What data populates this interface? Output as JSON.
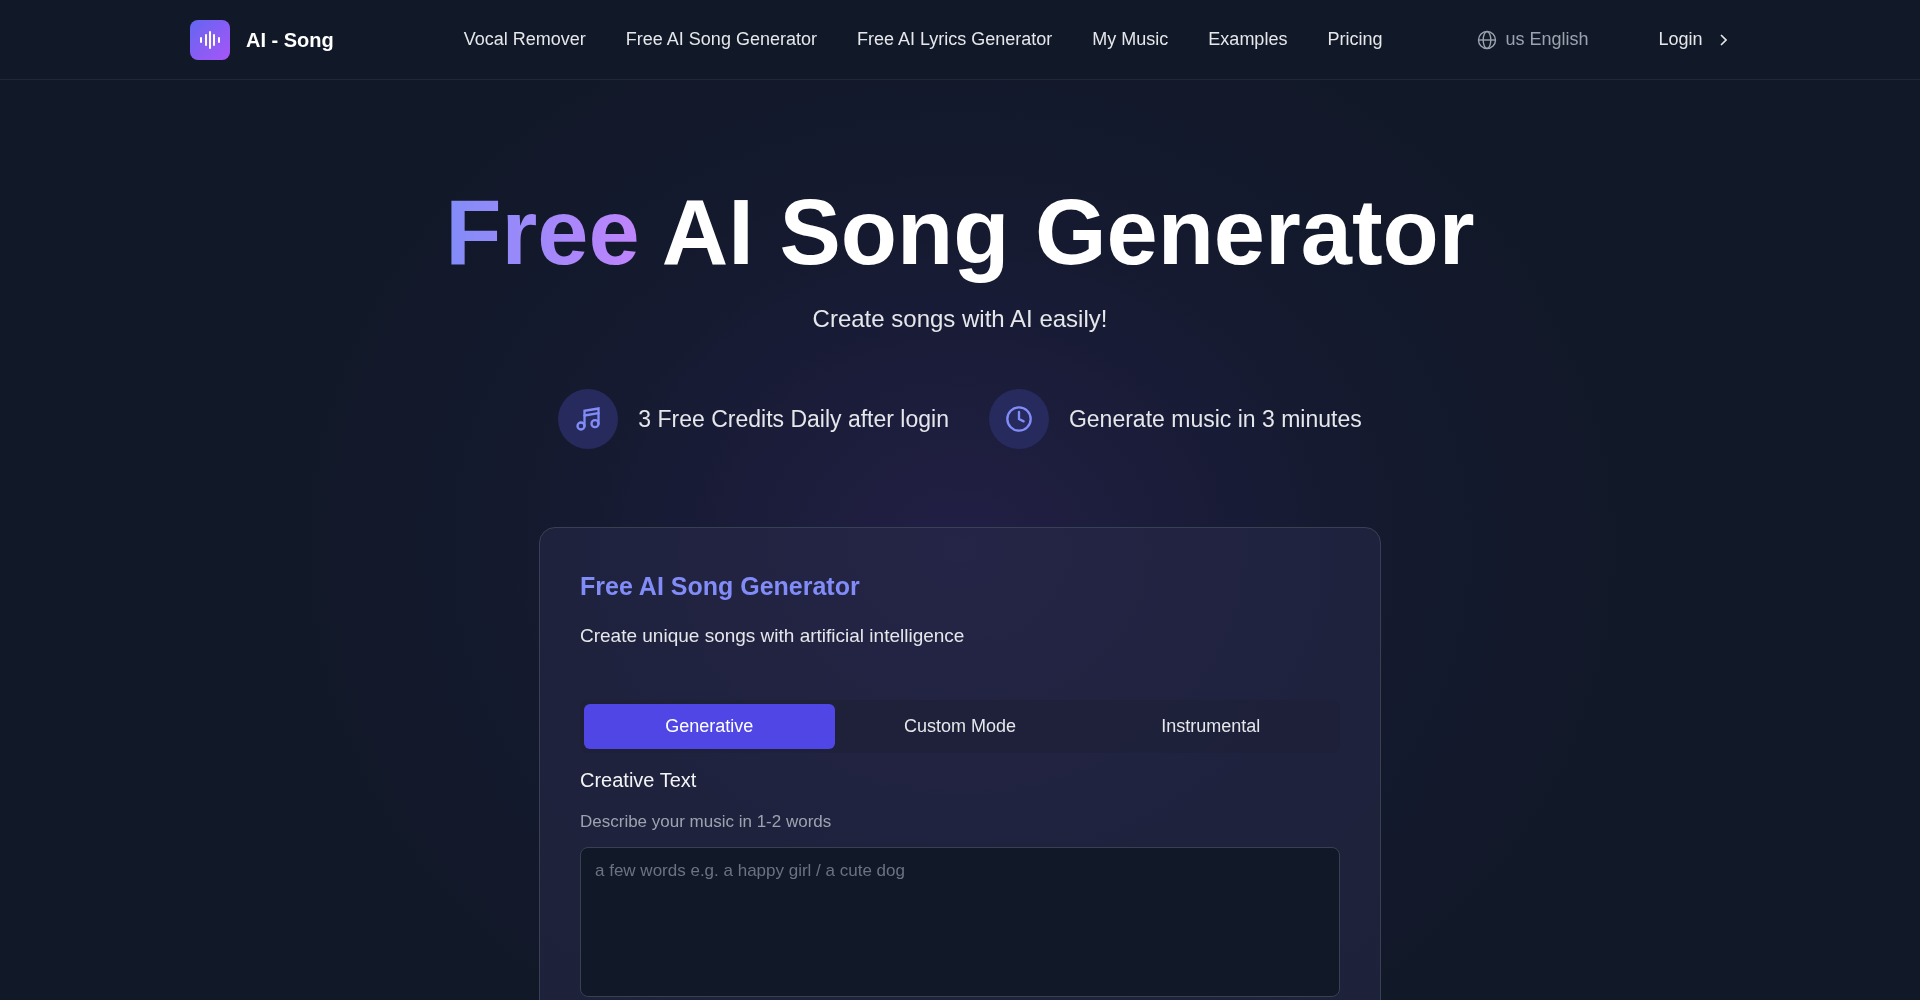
{
  "brand": {
    "name": "AI - Song"
  },
  "nav": {
    "links": [
      {
        "label": "Vocal Remover"
      },
      {
        "label": "Free AI Song Generator"
      },
      {
        "label": "Free AI Lyrics Generator"
      },
      {
        "label": "My Music"
      },
      {
        "label": "Examples"
      },
      {
        "label": "Pricing"
      }
    ],
    "language": {
      "flag": "us",
      "label": "English"
    },
    "login": "Login"
  },
  "hero": {
    "title_highlight": "Free",
    "title_rest": "AI Song Generator",
    "subtitle": "Create songs with AI easily!",
    "features": [
      {
        "kind": "music",
        "text": "3 Free Credits Daily after login"
      },
      {
        "kind": "clock",
        "text": "Generate music in 3 minutes"
      }
    ]
  },
  "generator": {
    "title": "Free AI Song Generator",
    "description": "Create unique songs with artificial intelligence",
    "tabs": [
      {
        "label": "Generative",
        "selected": true
      },
      {
        "label": "Custom Mode",
        "selected": false
      },
      {
        "label": "Instrumental",
        "selected": false
      }
    ],
    "field": {
      "label": "Creative Text",
      "hint": "Describe your music in 1-2 words",
      "placeholder": "a few words e.g. a happy girl / a cute dog"
    }
  }
}
